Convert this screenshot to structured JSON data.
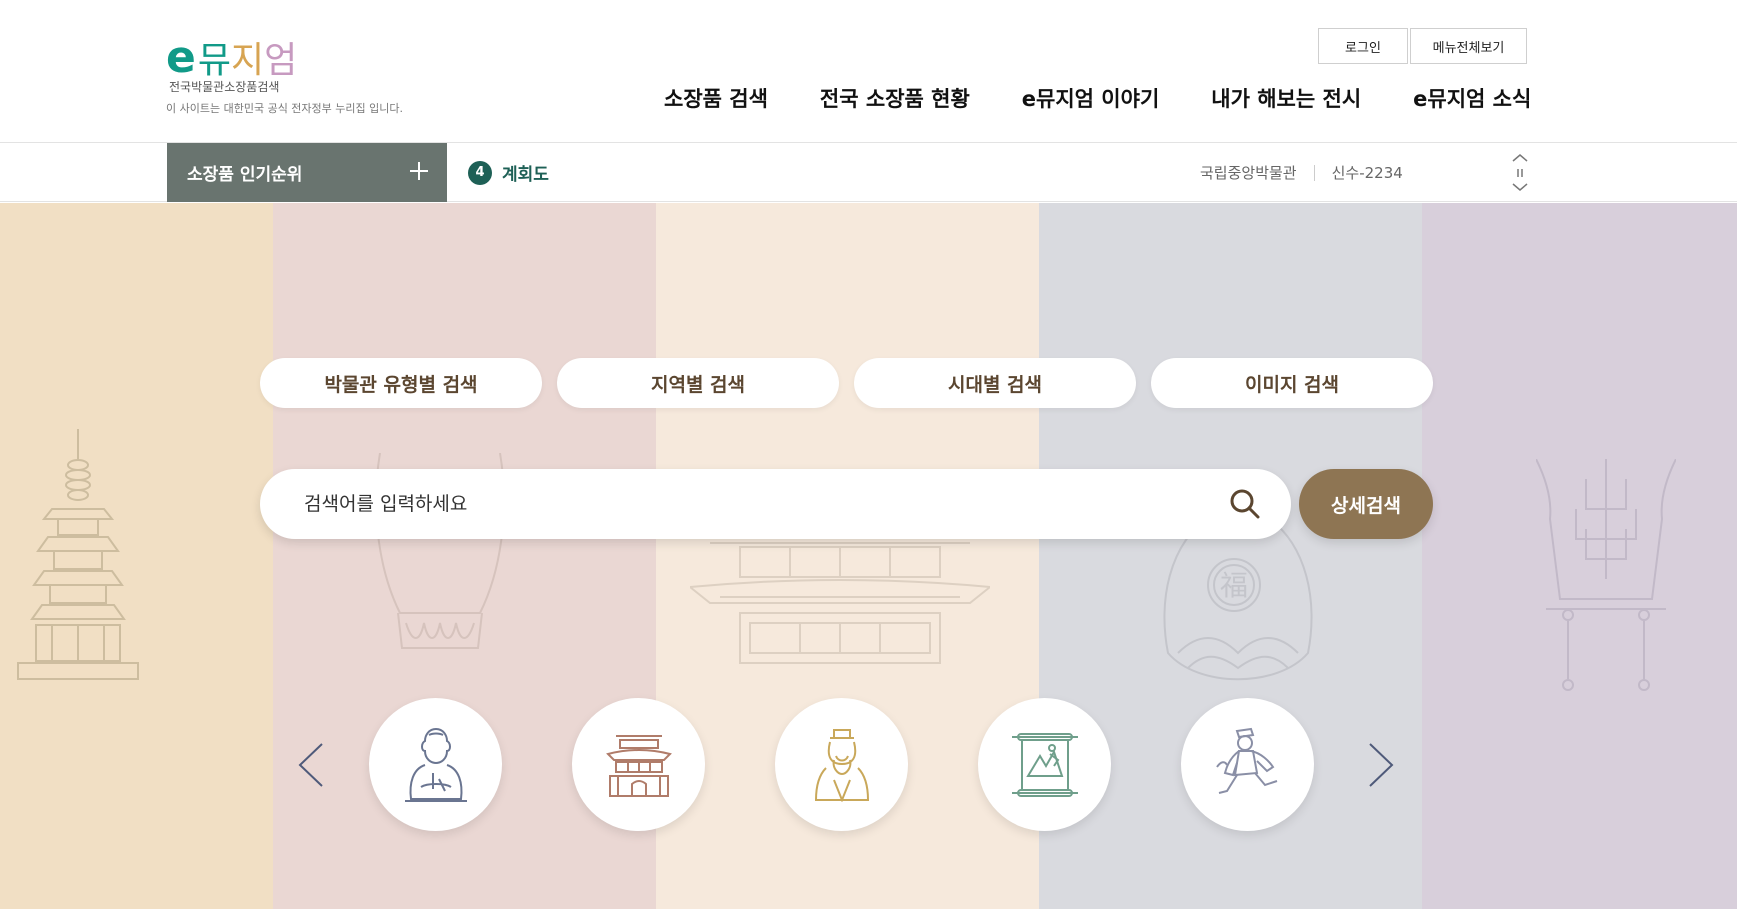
{
  "header": {
    "logo": {
      "mark_e": "e",
      "mark_c1": "뮤",
      "mark_c2": "지",
      "mark_c3": "엄",
      "subtitle": "전국박물관소장품검색",
      "notice": "이 사이트는 대한민국 공식 전자정부 누리집 입니다."
    },
    "util": {
      "login": "로그인",
      "menu_all": "메뉴전체보기"
    },
    "gnb": [
      "소장품 검색",
      "전국 소장품 현황",
      "e뮤지엄 이야기",
      "내가 해보는 전시",
      "e뮤지엄 소식"
    ]
  },
  "ranking": {
    "label": "소장품 인기순위",
    "current_rank": "4",
    "current_title": "계회도",
    "museum": "국립중앙박물관",
    "item_code": "신수-2234"
  },
  "hero": {
    "tabs": [
      "박물관 유형별 검색",
      "지역별 검색",
      "시대별 검색",
      "이미지 검색"
    ],
    "search": {
      "placeholder": "검색어를 입력하세요",
      "value": ""
    },
    "advanced_label": "상세검색",
    "categories": [
      {
        "icon": "buddha-statue-icon"
      },
      {
        "icon": "palace-gate-icon"
      },
      {
        "icon": "scholar-figure-icon"
      },
      {
        "icon": "scroll-painting-icon"
      },
      {
        "icon": "dancing-figure-icon"
      }
    ]
  },
  "colors": {
    "brand_green": "#119a88",
    "rank_bar": "#69746f",
    "accent_brown": "#8e7553",
    "tab_text": "#5b4630"
  }
}
